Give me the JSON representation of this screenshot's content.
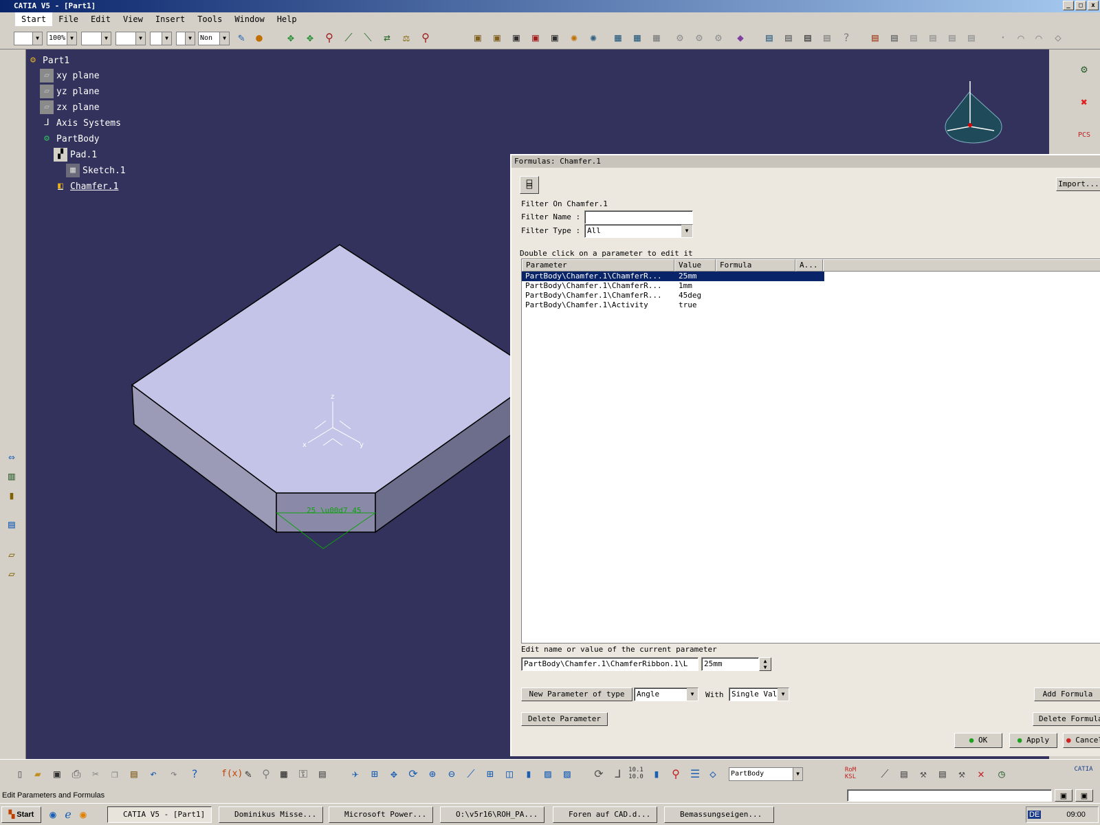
{
  "app": {
    "title": "CATIA V5 - [Part1]"
  },
  "menu": {
    "items": [
      "Start",
      "File",
      "Edit",
      "View",
      "Insert",
      "Tools",
      "Window",
      "Help"
    ]
  },
  "toolbar": {
    "zoom_value": "100%",
    "layer_value": "Non"
  },
  "tree": {
    "root": "Part1",
    "nodes": [
      "xy plane",
      "yz plane",
      "zx plane",
      "Axis Systems",
      "PartBody",
      "Pad.1",
      "Sketch.1",
      "Chamfer.1"
    ]
  },
  "viewport": {
    "dim_text": "25 \\u00d7 45",
    "axis_x": "x",
    "axis_y": "y",
    "axis_z": "z"
  },
  "dialog": {
    "title": "Formulas: Chamfer.1",
    "import_label": "Import...",
    "filter_on": "Filter On Chamfer.1",
    "filter_name_label": "Filter Name :",
    "filter_name_value": "",
    "filter_type_label": "Filter Type :",
    "filter_type_value": "All",
    "hint": "Double click on a parameter to edit it",
    "columns": [
      "Parameter",
      "Value",
      "Formula",
      "A..."
    ],
    "rows": [
      {
        "parameter": "PartBody\\Chamfer.1\\ChamferR...",
        "value": "25mm"
      },
      {
        "parameter": "PartBody\\Chamfer.1\\ChamferR...",
        "value": "1mm"
      },
      {
        "parameter": "PartBody\\Chamfer.1\\ChamferR...",
        "value": "45deg"
      },
      {
        "parameter": "PartBody\\Chamfer.1\\Activity",
        "value": "true"
      }
    ],
    "edit_label": "Edit name or value of the current parameter",
    "edit_name": "PartBody\\Chamfer.1\\ChamferRibbon.1\\L",
    "edit_value": "25mm",
    "new_param_label": "New Parameter of type",
    "new_param_type": "Angle",
    "with_label": "With",
    "with_value": "Single Val",
    "add_formula": "Add Formula",
    "delete_parameter": "Delete Parameter",
    "delete_formula": "Delete Formula",
    "ok": "OK",
    "apply": "Apply",
    "cancel": "Cancel"
  },
  "bottom_toolbar": {
    "body_select": "PartBody"
  },
  "status": {
    "text": "Edit Parameters and Formulas"
  },
  "taskbar": {
    "start": "Start",
    "tasks": [
      "CATIA V5 - [Part1]",
      "Dominikus Misse...",
      "Microsoft Power...",
      "O:\\v5r16\\ROH_PA...",
      "Foren auf CAD.d...",
      "Bemassungseigen..."
    ],
    "lang": "DE",
    "time": "09:00"
  }
}
